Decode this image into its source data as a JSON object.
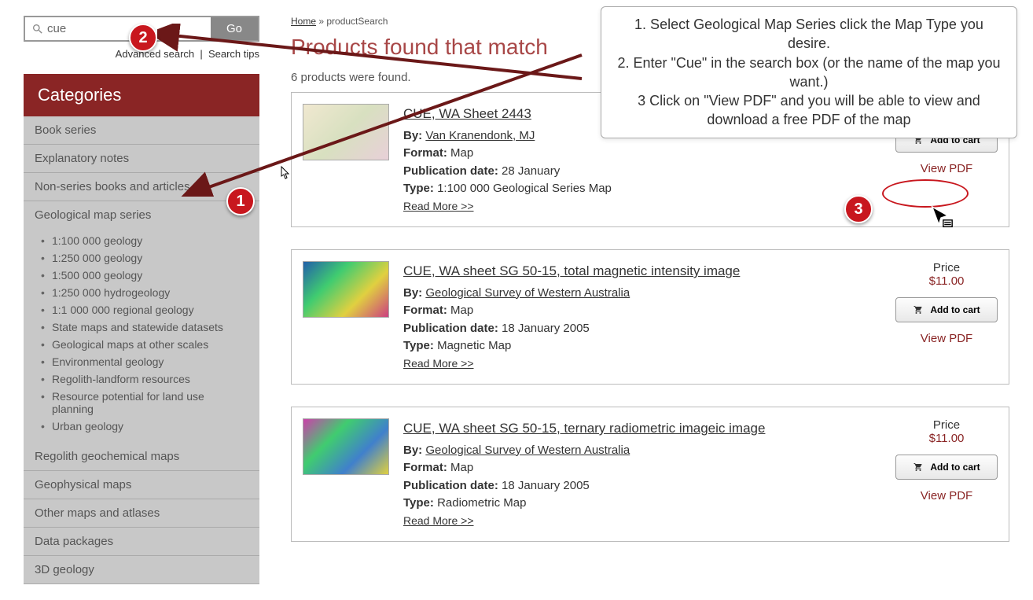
{
  "search": {
    "value": "cue",
    "go": "Go",
    "advanced": "Advanced search",
    "tips": "Search tips"
  },
  "breadcrumb": {
    "home": "Home",
    "sep": " » ",
    "current": "productSearch"
  },
  "page_title": "Products found that match",
  "result_count": "6 products were found.",
  "categories_header": "Categories",
  "categories": [
    "Book series",
    "Explanatory notes",
    "Non-series books and articles",
    "Geological map series",
    "Regolith geochemical maps",
    "Geophysical maps",
    "Other maps and atlases",
    "Data packages",
    "3D geology"
  ],
  "subcategories": [
    "1:100 000 geology",
    "1:250 000 geology",
    "1:500 000 geology",
    "1:250 000 hydrogeology",
    "1:1 000 000 regional geology",
    "State maps and statewide datasets",
    "Geological maps at other scales",
    "Environmental geology",
    "Regolith-landform resources",
    "Resource potential for land use planning",
    "Urban geology"
  ],
  "products": [
    {
      "title": "CUE, WA Sheet 2443",
      "author": "Van Kranendonk, MJ",
      "format": "Map",
      "pubdate": "28 January",
      "type": "1:100 000 Geological Series Map",
      "price_label": "",
      "price": "",
      "add_cart": "Add to cart",
      "view_pdf": "View PDF"
    },
    {
      "title": "CUE, WA sheet SG 50-15, total magnetic intensity image",
      "author": "Geological Survey of Western Australia",
      "format": "Map",
      "pubdate": "18 January 2005",
      "type": "Magnetic Map",
      "price_label": "Price",
      "price": "$11.00",
      "add_cart": "Add to cart",
      "view_pdf": "View PDF"
    },
    {
      "title": "CUE, WA sheet SG 50-15, ternary radiometric imageic image",
      "author": "Geological Survey of Western Australia",
      "format": "Map",
      "pubdate": "18 January 2005",
      "type": "Radiometric Map",
      "price_label": "Price",
      "price": "$11.00",
      "add_cart": "Add to cart",
      "view_pdf": "View PDF"
    }
  ],
  "labels": {
    "by": "By:",
    "format": "Format:",
    "pubdate": "Publication date:",
    "type": "Type:",
    "read_more": "Read More >>"
  },
  "callout": {
    "line1": "1. Select Geological Map Series click the Map Type you desire.",
    "line2": "2. Enter \"Cue\" in the search box (or the name of the map you want.)",
    "line3": "3 Click on \"View PDF\" and you will be able to view and download a free PDF of the map"
  },
  "badges": {
    "b1": "1",
    "b2": "2",
    "b3": "3"
  }
}
